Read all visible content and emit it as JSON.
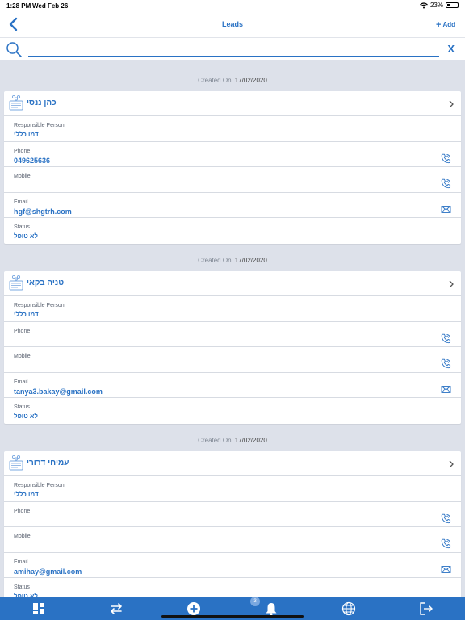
{
  "status_bar": {
    "time": "1:28 PM",
    "date": "Wed Feb 26",
    "battery": "23%",
    "battery_level": 0.23
  },
  "navbar": {
    "title": "Leads",
    "add_label": "Add"
  },
  "search": {
    "value": "",
    "placeholder": ""
  },
  "created_label": "Created On",
  "field_labels": {
    "responsible": "Responsible Person",
    "phone": "Phone",
    "mobile": "Mobile",
    "email": "Email",
    "status": "Status"
  },
  "leads": [
    {
      "created_date": "17/02/2020",
      "name": "כהן ננסי",
      "responsible": "דמו כללי",
      "phone": "049625636",
      "mobile": "",
      "email": "hgf@shgtrh.com",
      "status": "לא טופל"
    },
    {
      "created_date": "17/02/2020",
      "name": "טניה בקאי",
      "responsible": "דמו כללי",
      "phone": "",
      "mobile": "",
      "email": "tanya3.bakay@gmail.com",
      "status": "לא טופל"
    },
    {
      "created_date": "17/02/2020",
      "name": "עמיחי דרורי",
      "responsible": "דמו כללי",
      "phone": "",
      "mobile": "",
      "email": "amihay@gmail.com",
      "status": "לא טופל"
    }
  ],
  "tabbar": {
    "notification_count": "3"
  },
  "colors": {
    "accent": "#2a72c4",
    "background": "#dde1ea",
    "tabbar": "#2a72c4"
  }
}
